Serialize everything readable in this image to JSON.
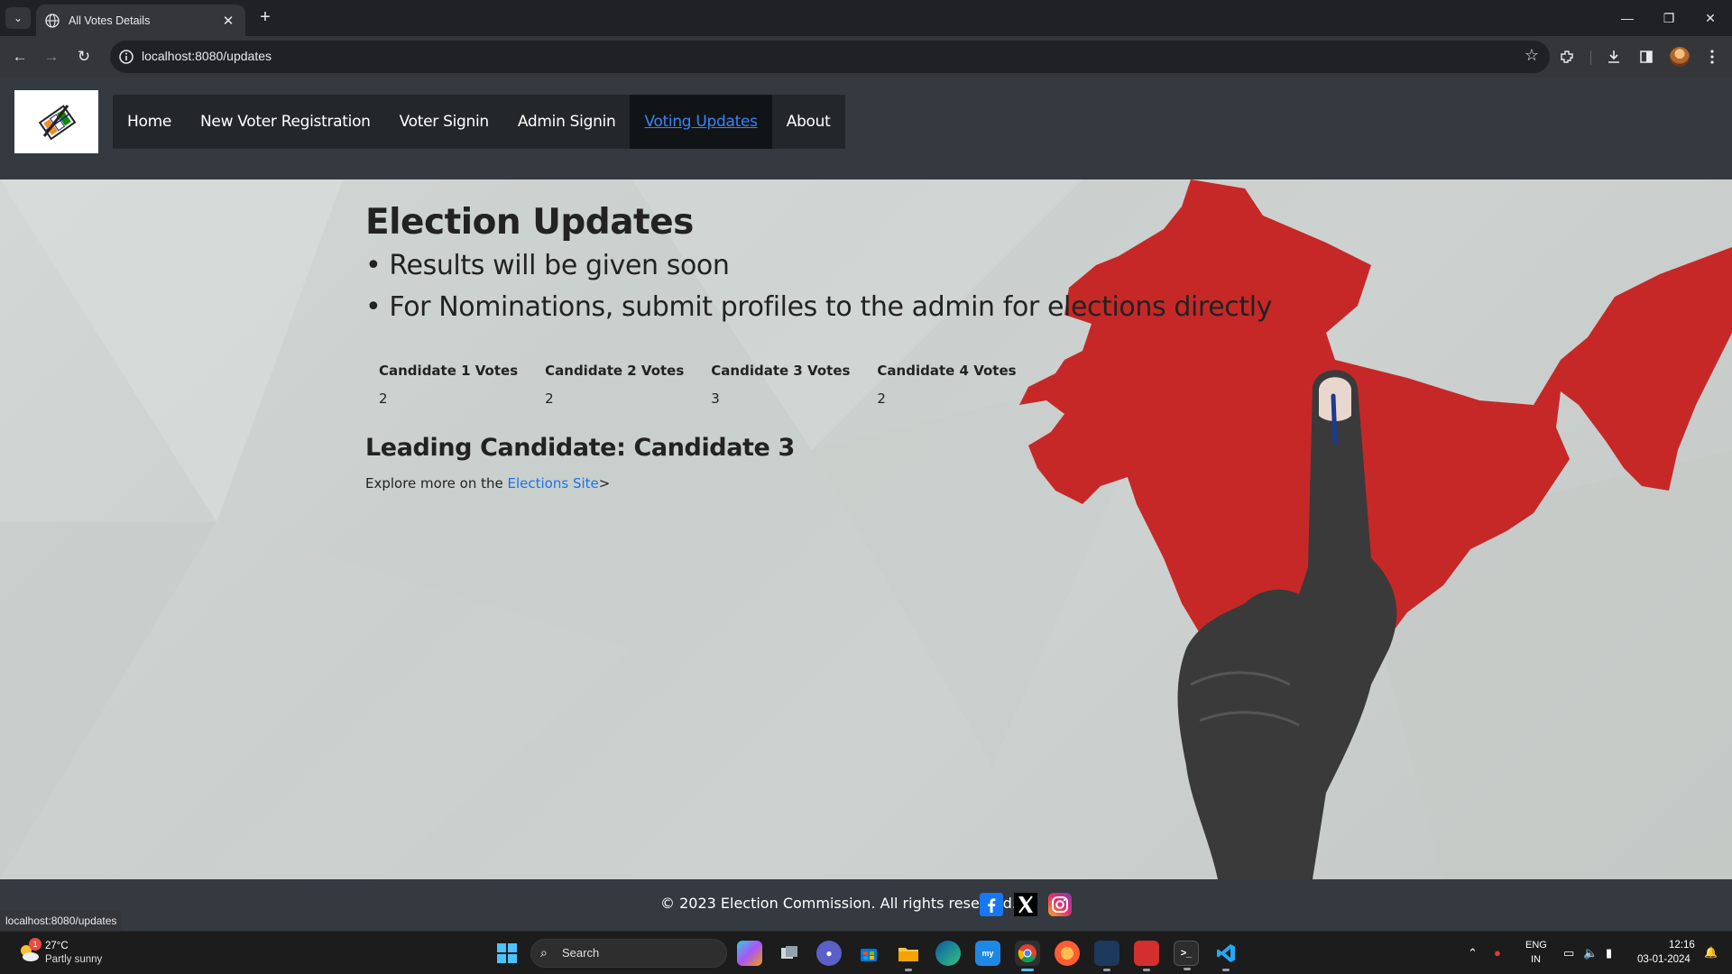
{
  "browser": {
    "tab_title": "All Votes Details",
    "url": "localhost:8080/updates",
    "status_url": "localhost:8080/updates"
  },
  "nav": {
    "items": [
      {
        "label": "Home"
      },
      {
        "label": "New Voter Registration"
      },
      {
        "label": "Voter Signin"
      },
      {
        "label": "Admin Signin"
      },
      {
        "label": "Voting Updates",
        "active": true
      },
      {
        "label": "About"
      }
    ]
  },
  "content": {
    "title": "Election Updates",
    "bullets": [
      "• Results will be given soon",
      "• For Nominations, submit profiles to the admin for elections directly"
    ],
    "table": {
      "headers": [
        "Candidate 1 Votes",
        "Candidate 2 Votes",
        "Candidate 3 Votes",
        "Candidate 4 Votes"
      ],
      "values": [
        "2",
        "2",
        "3",
        "2"
      ]
    },
    "leading": "Leading Candidate: Candidate 3",
    "explore_prefix": "Explore more on the ",
    "explore_link": "Elections Site",
    "explore_suffix": ">"
  },
  "footer": {
    "copyright": "© 2023 Election Commission. All rights reserved.",
    "social_icons": [
      "facebook-icon",
      "x-icon",
      "instagram-icon"
    ]
  },
  "colors": {
    "header_bg": "#343a40",
    "map_red": "#c62828",
    "link": "#1a73e8"
  },
  "taskbar": {
    "temperature": "27°C",
    "weather": "Partly sunny",
    "weather_badge": "1",
    "search_placeholder": "Search",
    "lang_line1": "ENG",
    "lang_line2": "IN",
    "time": "12:16",
    "date": "03-01-2024"
  }
}
